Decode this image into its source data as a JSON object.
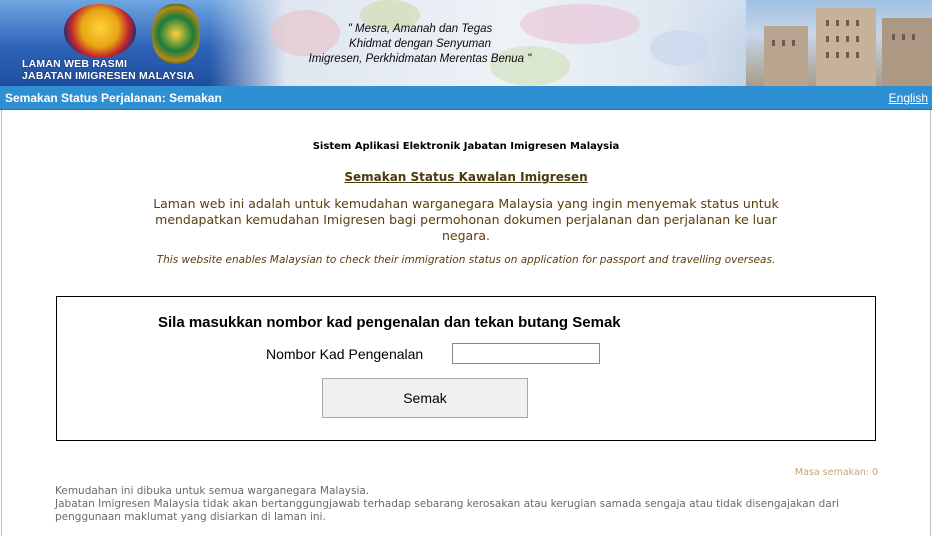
{
  "banner": {
    "site_title_line1": "LAMAN WEB RASMI",
    "site_title_line2": "JABATAN IMIGRESEN MALAYSIA",
    "motto_line1": "\" Mesra, Amanah dan Tegas",
    "motto_line2": "Khidmat dengan Senyuman",
    "motto_line3": "Imigresen, Perkhidmatan Merentas Benua \""
  },
  "navbar": {
    "title": "Semakan Status Perjalanan: Semakan",
    "language_link": "English"
  },
  "main": {
    "system_title": "Sistem Aplikasi Elektronik Jabatan Imigresen Malaysia",
    "heading": "Semakan Status Kawalan Imigresen",
    "description_ms": "Laman web ini adalah untuk kemudahan warganegara Malaysia yang ingin menyemak status untuk mendapatkan kemudahan Imigresen bagi permohonan dokumen perjalanan dan perjalanan ke luar negara.",
    "description_en": "This website enables Malaysian to check their immigration status on application for passport and travelling overseas."
  },
  "form": {
    "heading": "Sila masukkan nombor kad pengenalan dan tekan butang Semak",
    "ic_label": "Nombor Kad Pengenalan",
    "ic_value": "",
    "submit_label": "Semak"
  },
  "status": {
    "timer": "Masa semakan: 0"
  },
  "footer": {
    "line1": "Kemudahan ini dibuka untuk semua warganegara Malaysia.",
    "line2": "Jabatan Imigresen Malaysia tidak akan bertanggungjawab terhadap sebarang kerosakan atau kerugian samada sengaja atau tidak disengajakan dari penggunaan maklumat yang disiarkan di laman ini."
  },
  "colors": {
    "navbar_bg": "#2f8fd3",
    "heading_text": "#4b3a0c",
    "description_text": "#5b3d0c"
  }
}
